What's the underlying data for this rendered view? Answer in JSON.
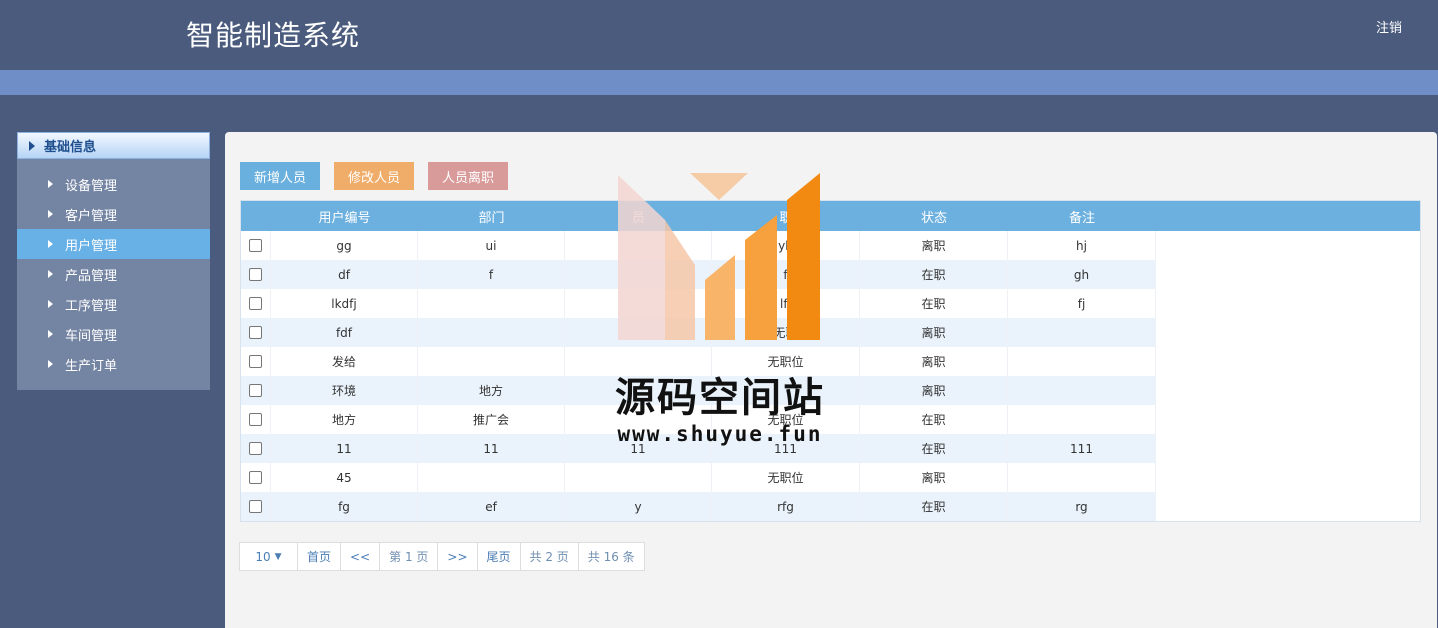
{
  "header": {
    "title": "智能制造系统",
    "logout_label": "注销"
  },
  "sidebar": {
    "section_label": "基础信息",
    "items": [
      {
        "label": "设备管理"
      },
      {
        "label": "客户管理"
      },
      {
        "label": "用户管理",
        "active": true
      },
      {
        "label": "产品管理"
      },
      {
        "label": "工序管理"
      },
      {
        "label": "车间管理"
      },
      {
        "label": "生产订单"
      }
    ]
  },
  "toolbar": {
    "add_label": "新增人员",
    "edit_label": "修改人员",
    "leave_label": "人员离职"
  },
  "table": {
    "columns": [
      "",
      "用户编号",
      "部门",
      "员",
      "职",
      "状态",
      "备注"
    ],
    "rows": [
      [
        "gg",
        "ui",
        "",
        "yh",
        "离职",
        "hj"
      ],
      [
        "df",
        "f",
        "",
        "f",
        "在职",
        "gh"
      ],
      [
        "lkdfj",
        "",
        "",
        "lfj",
        "在职",
        "fj"
      ],
      [
        "fdf",
        "",
        "",
        "无职",
        "离职",
        ""
      ],
      [
        "发给",
        "",
        "",
        "无职位",
        "离职",
        ""
      ],
      [
        "环境",
        "地方",
        "",
        "",
        "离职",
        ""
      ],
      [
        "地方",
        "推广会",
        "",
        "无职位",
        "在职",
        ""
      ],
      [
        "11",
        "11",
        "11",
        "111",
        "在职",
        "111"
      ],
      [
        "45",
        "",
        "",
        "无职位",
        "离职",
        ""
      ],
      [
        "fg",
        "ef",
        "y",
        "rfg",
        "在职",
        "rg"
      ]
    ]
  },
  "pager": {
    "page_size": "10",
    "first": "首页",
    "prev": "<<",
    "current": "第 1 页",
    "next": ">>",
    "last": "尾页",
    "total_pages": "共 2 页",
    "total_items": "共 16 条"
  },
  "watermark": {
    "name": "源码空间站",
    "url": "www.shuyue.fun"
  },
  "colors": {
    "background": "#4a5b7d",
    "stripe": "#6f8dc6",
    "accent": "#6cb0e0",
    "add_button": "#6ab0de",
    "edit_button": "#f0ad6a",
    "leave_button": "#d99a9a"
  }
}
